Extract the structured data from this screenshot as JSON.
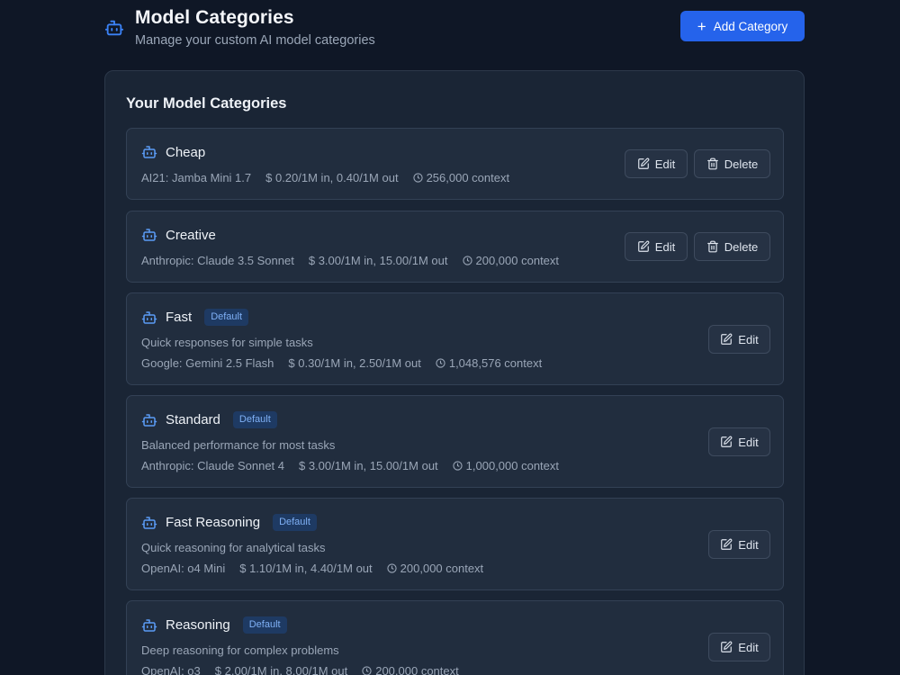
{
  "header": {
    "title": "Model Categories",
    "subtitle": "Manage your custom AI model categories",
    "add_button": "Add Category"
  },
  "panel": {
    "title": "Your Model Categories"
  },
  "actions": {
    "edit": "Edit",
    "delete": "Delete"
  },
  "colors": {
    "accent": "#2563eb",
    "badge_bg": "#1e3a63",
    "badge_text": "#7fb0f5"
  },
  "categories": [
    {
      "name": "Cheap",
      "badge": "",
      "description": "",
      "model": "AI21: Jamba Mini 1.7",
      "price": "0.20/1M in, 0.40/1M out",
      "context": "256,000 context"
    },
    {
      "name": "Creative",
      "badge": "",
      "description": "",
      "model": "Anthropic: Claude 3.5 Sonnet",
      "price": "3.00/1M in, 15.00/1M out",
      "context": "200,000 context"
    },
    {
      "name": "Fast",
      "badge": "Default",
      "description": "Quick responses for simple tasks",
      "model": "Google: Gemini 2.5 Flash",
      "price": "0.30/1M in, 2.50/1M out",
      "context": "1,048,576 context"
    },
    {
      "name": "Standard",
      "badge": "Default",
      "description": "Balanced performance for most tasks",
      "model": "Anthropic: Claude Sonnet 4",
      "price": "3.00/1M in, 15.00/1M out",
      "context": "1,000,000 context"
    },
    {
      "name": "Fast Reasoning",
      "badge": "Default",
      "description": "Quick reasoning for analytical tasks",
      "model": "OpenAI: o4 Mini",
      "price": "1.10/1M in, 4.40/1M out",
      "context": "200,000 context"
    },
    {
      "name": "Reasoning",
      "badge": "Default",
      "description": "Deep reasoning for complex problems",
      "model": "OpenAI: o3",
      "price": "2.00/1M in, 8.00/1M out",
      "context": "200,000 context"
    }
  ]
}
